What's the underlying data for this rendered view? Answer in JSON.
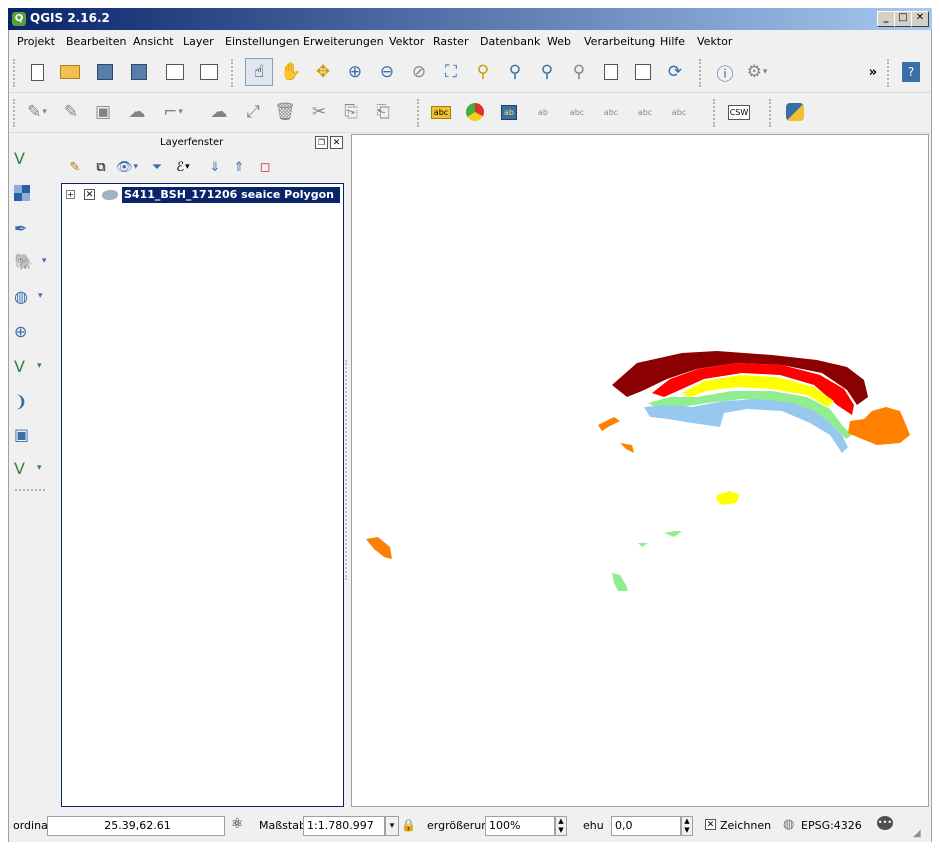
{
  "window": {
    "title": "QGIS 2.16.2",
    "controls": [
      "_",
      "□",
      "✕"
    ]
  },
  "menubar": [
    "Projekt",
    "Bearbeiten",
    "Ansicht",
    "Layer",
    "Einstellungen",
    "Erweiterungen",
    "Vektor",
    "Raster",
    "Datenbank",
    "Web",
    "Verarbeitung",
    "Hilfe",
    "Vektor"
  ],
  "toolbar_overflow": "»",
  "label_toolbar": {
    "abc": "abc",
    "csw": "CSW"
  },
  "layer_panel": {
    "title": "Layerfenster",
    "layers": [
      {
        "name": "S411_BSH_171206 seaice Polygon",
        "visible": true,
        "expanded": false
      }
    ]
  },
  "statusbar": {
    "coord_label": "ordina",
    "coord_value": "25.39,62.61",
    "scale_label": "Maßstab",
    "scale_value": "1:1.780.997",
    "magnifier_label": "ergrößerun",
    "magnifier_value": "100%",
    "rotation_label": "ehu",
    "rotation_value": "0,0",
    "render_label": "Zeichnen",
    "crs": "EPSG:4326"
  },
  "colors": {
    "title_start": "#0a246a",
    "title_end": "#a6caf0",
    "selection": "#0a246a",
    "ice_darkred": "#8b0000",
    "ice_red": "#ff0000",
    "ice_yellow": "#ffff00",
    "ice_green": "#90ee90",
    "ice_lightblue": "#96c8f0",
    "ice_orange": "#ff7f00"
  }
}
